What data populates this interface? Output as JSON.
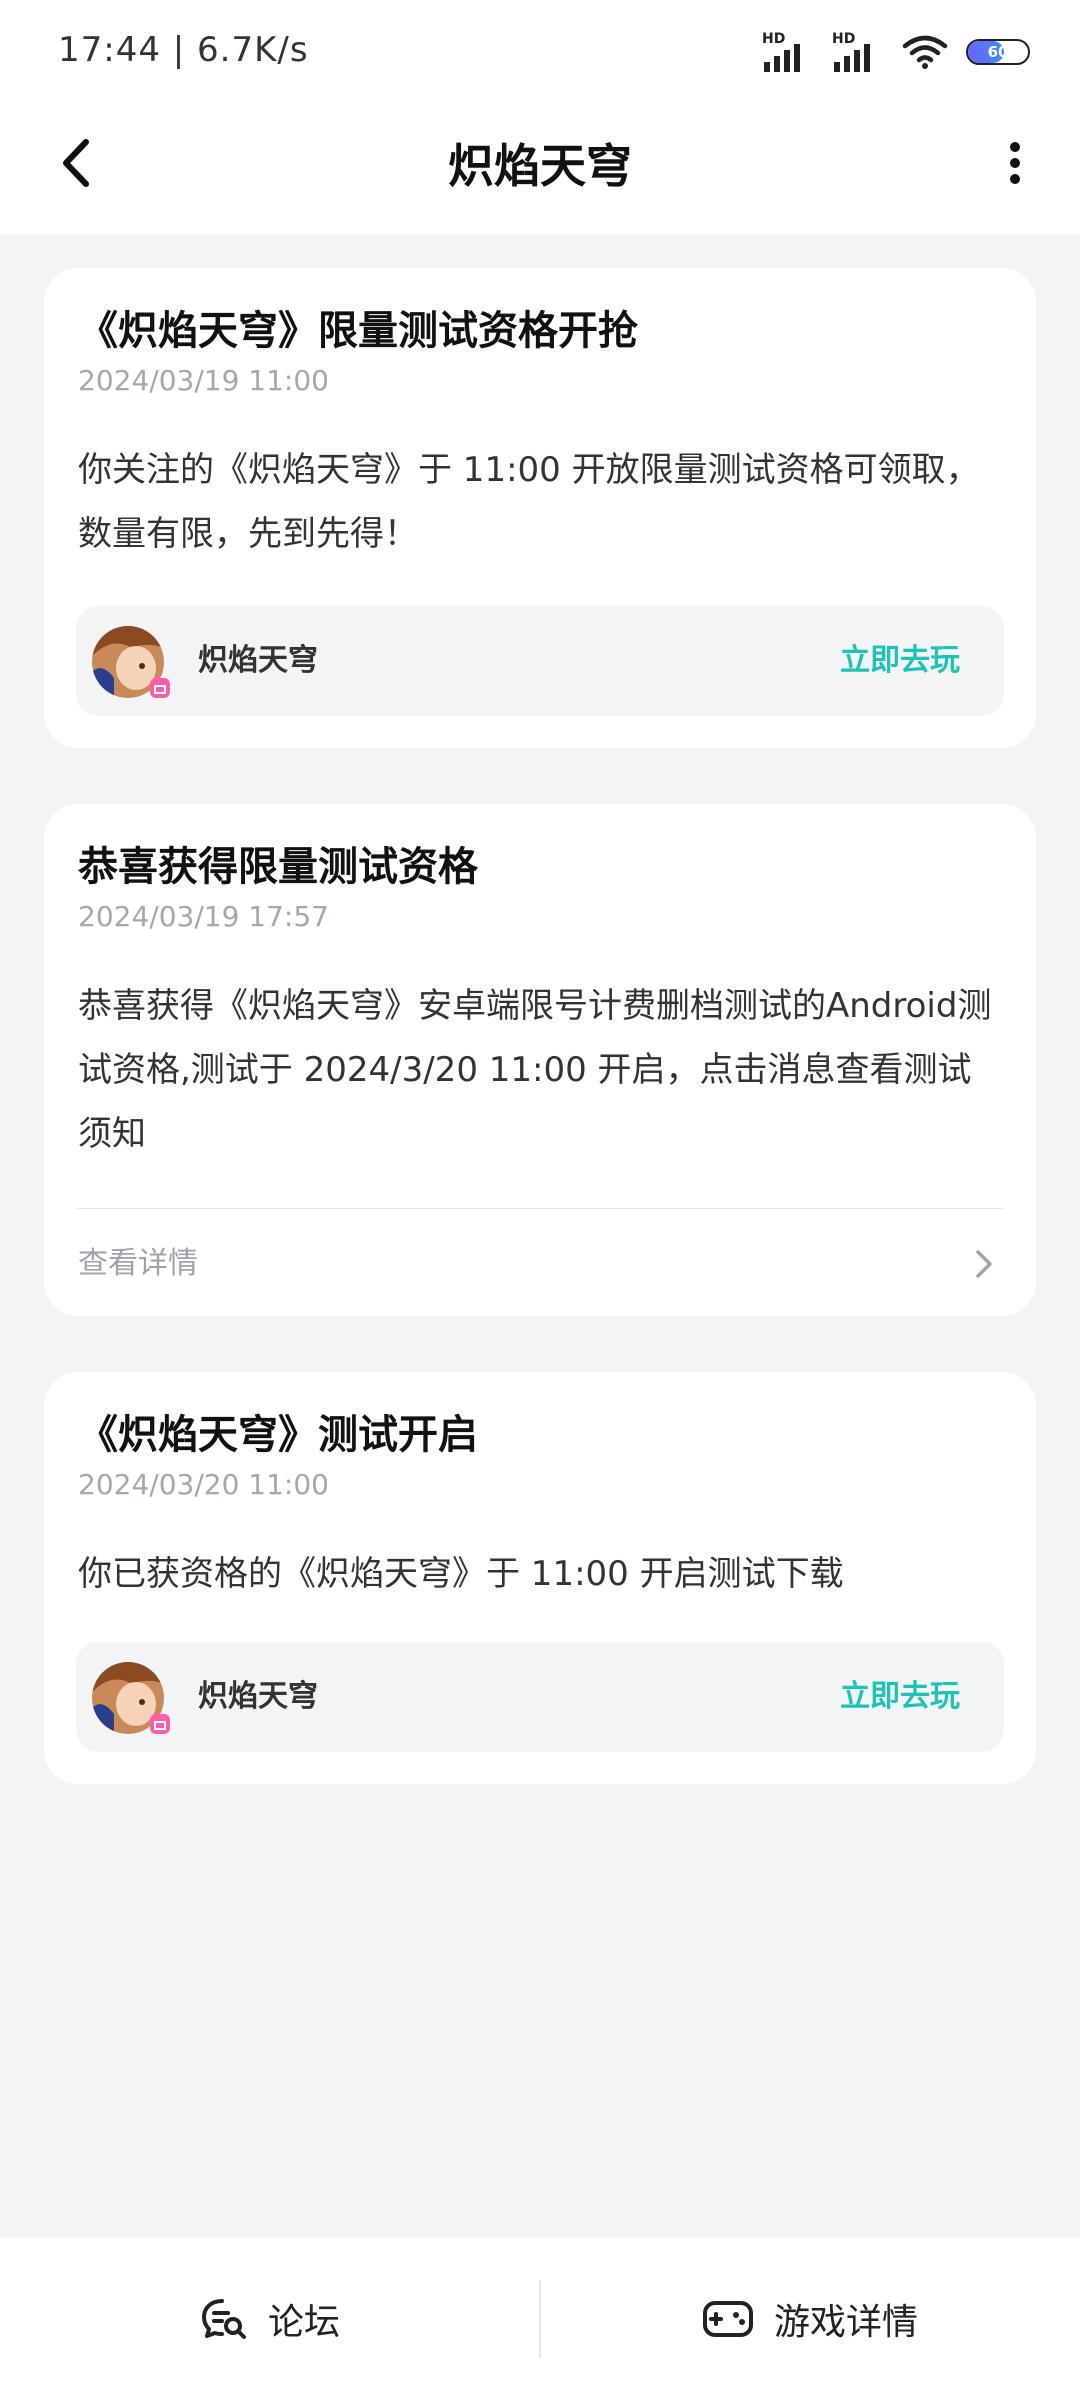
{
  "status_bar": {
    "time": "17:44 | 6.7K/s",
    "signal_label_1": "HD",
    "signal_label_2": "HD",
    "battery": "60"
  },
  "header": {
    "title": "炽焰天穹"
  },
  "messages": [
    {
      "title": "《炽焰天穹》限量测试资格开抢",
      "time": "2024/03/19 11:00",
      "body": "你关注的《炽焰天穹》于 11:00 开放限量测试资格可领取，数量有限，先到先得！",
      "game_name": "炽焰天穹",
      "action_label": "立即去玩"
    },
    {
      "title": "恭喜获得限量测试资格",
      "time": "2024/03/19 17:57",
      "body": "恭喜获得《炽焰天穹》安卓端限号计费删档测试的Android测试资格,测试于 2024/3/20 11:00 开启，点击消息查看测试须知",
      "link_label": "查看详情"
    },
    {
      "title": "《炽焰天穹》测试开启",
      "time": "2024/03/20 11:00",
      "body": "你已获资格的《炽焰天穹》于 11:00 开启测试下载",
      "game_name": "炽焰天穹",
      "action_label": "立即去玩"
    }
  ],
  "bottom_bar": {
    "forum_label": "论坛",
    "forum_icon": "chat-search-icon",
    "game_detail_label": "游戏详情",
    "game_detail_icon": "gamepad-icon"
  },
  "colors": {
    "accent": "#1fc3b6",
    "background": "#f3f4f6",
    "muted_text": "#a3a7ae"
  }
}
